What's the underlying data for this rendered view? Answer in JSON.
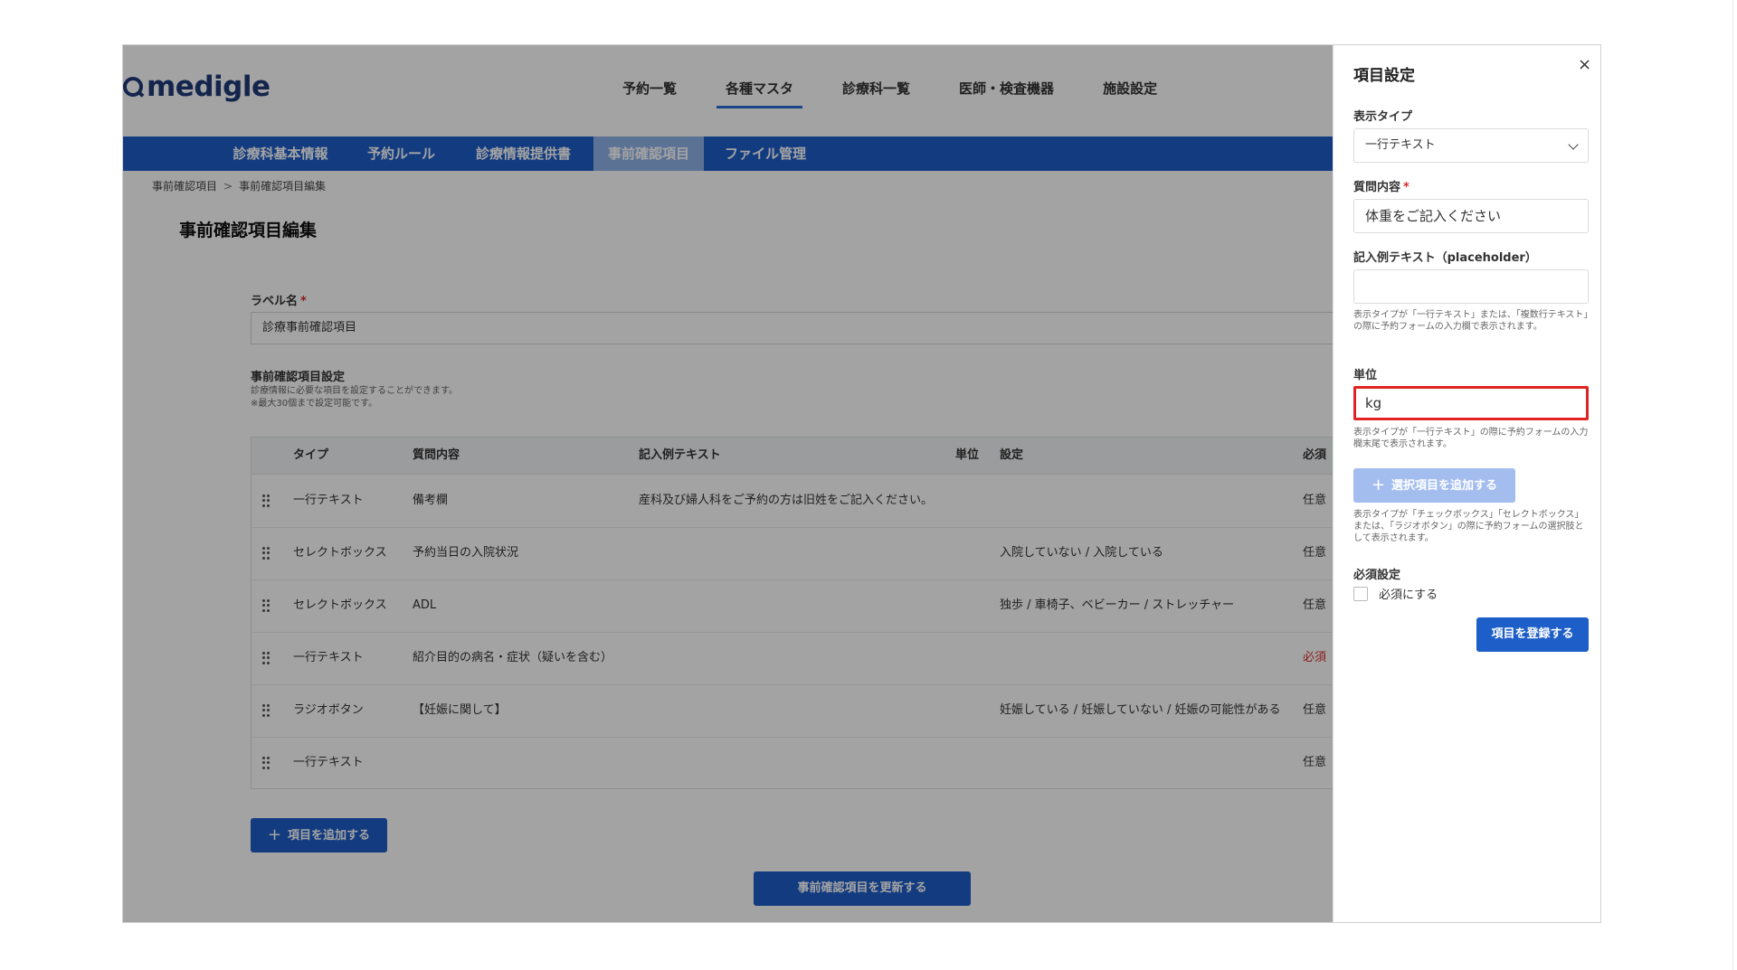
{
  "logo": "medigle",
  "top_nav": [
    "予約一覧",
    "各種マスタ",
    "診療科一覧",
    "医師・検査機器",
    "施設設定"
  ],
  "sub_nav": [
    "診療科基本情報",
    "予約ルール",
    "診療情報提供書",
    "事前確認項目",
    "ファイル管理"
  ],
  "breadcrumb": {
    "parent": "事前確認項目",
    "separator": ">",
    "current": "事前確認項目編集"
  },
  "page_title": "事前確認項目編集",
  "label_field": {
    "label": "ラベル名",
    "required_mark": "*",
    "value": "診療事前確認項目"
  },
  "settings": {
    "title": "事前確認項目設定",
    "help1": "診療情報に必要な項目を設定することができます。",
    "help2": "※最大30個まで設定可能です。"
  },
  "table": {
    "headers": {
      "type": "タイプ",
      "question": "質問内容",
      "example": "記入例テキスト",
      "unit": "単位",
      "setting": "設定",
      "required": "必須"
    },
    "rows": [
      {
        "type": "一行テキスト",
        "question": "備考欄",
        "example": "産科及び婦人科をご予約の方は旧姓をご記入ください。",
        "unit": "",
        "setting": "",
        "required": "任意"
      },
      {
        "type": "セレクトボックス",
        "question": "予約当日の入院状況",
        "example": "",
        "unit": "",
        "setting": "入院していない / 入院している",
        "required": "任意"
      },
      {
        "type": "セレクトボックス",
        "question": "ADL",
        "example": "",
        "unit": "",
        "setting": "独歩 / 車椅子、ベビーカー / ストレッチャー",
        "required": "任意"
      },
      {
        "type": "一行テキスト",
        "question": "紹介目的の病名・症状（疑いを含む）",
        "example": "",
        "unit": "",
        "setting": "",
        "required": "必須"
      },
      {
        "type": "ラジオボタン",
        "question": "【妊娠に関して】",
        "example": "",
        "unit": "",
        "setting": "妊娠している / 妊娠していない / 妊娠の可能性がある",
        "required": "任意"
      },
      {
        "type": "一行テキスト",
        "question": "",
        "example": "",
        "unit": "",
        "setting": "",
        "required": "任意"
      }
    ]
  },
  "add_item_button": "項目を追加する",
  "update_button": "事前確認項目を更新する",
  "panel": {
    "title": "項目設定",
    "close": "×",
    "display_type_label": "表示タイプ",
    "display_type_value": "一行テキスト",
    "question_label": "質問内容",
    "required_mark": "*",
    "question_value": "体重をご記入ください",
    "placeholder_label": "記入例テキスト（placeholder）",
    "placeholder_value": "",
    "placeholder_help": "表示タイプが「一行テキスト」または、「複数行テキスト」の際に予約フォームの入力欄で表示されます。",
    "unit_label": "単位",
    "unit_value": "kg",
    "unit_help": "表示タイプが「一行テキスト」の際に予約フォームの入力欄末尾で表示されます。",
    "add_option_button": "選択項目を追加する",
    "option_help": "表示タイプが「チェックボックス」「セレクトボックス」または、「ラジオボタン」の際に予約フォームの選択肢として表示されます。",
    "required_setting_label": "必須設定",
    "required_checkbox_label": "必須にする",
    "register_button": "項目を登録する"
  },
  "colors": {
    "primary": "#1e5ec8",
    "subnav_active": "#8fb2ea",
    "highlight": "#e02424",
    "required": "#d92b2b"
  }
}
